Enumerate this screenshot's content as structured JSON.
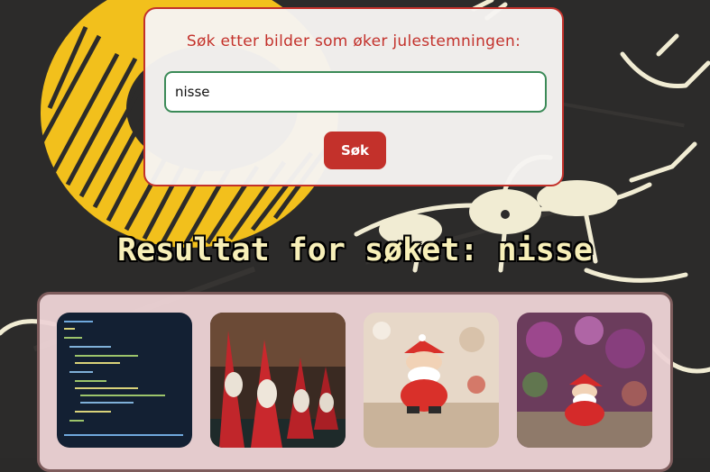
{
  "search": {
    "prompt": "Søk etter bilder som øker julestemningen:",
    "value": "nisse",
    "button_label": "Søk"
  },
  "results": {
    "heading": "Resultat for søket: nisse",
    "images": [
      {
        "subject": "code-screenshot"
      },
      {
        "subject": "row-of-santa-figurines"
      },
      {
        "subject": "santa-figurine"
      },
      {
        "subject": "santa-figurine-with-bokeh"
      }
    ]
  },
  "colors": {
    "accent": "#c3312b",
    "input_border": "#3b8a57",
    "heading_text": "#f7efb8",
    "panel_bg": "#ecd2d4",
    "panel_border": "#7d5c5c"
  }
}
